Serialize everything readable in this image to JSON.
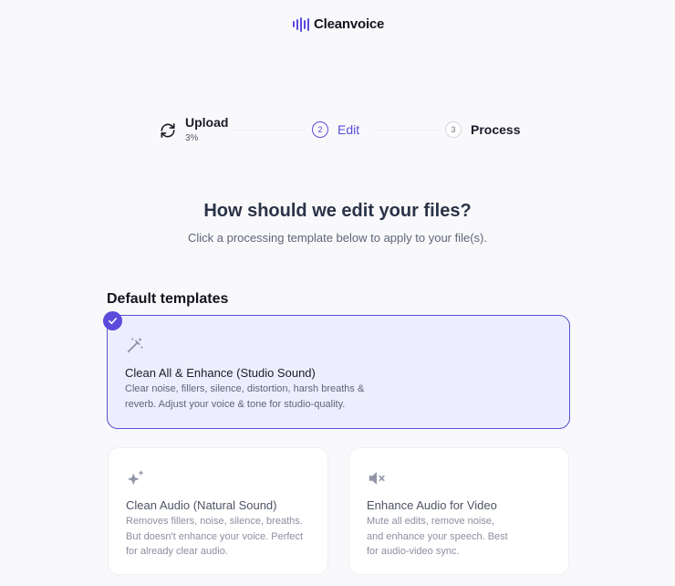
{
  "app": {
    "name": "Cleanvoice",
    "accent": "#5b4bdc"
  },
  "stepper": {
    "steps": [
      {
        "label": "Upload",
        "sub": "3%",
        "icon": "refresh-icon",
        "state": "in-progress",
        "progress_percent": 3
      },
      {
        "number": "2",
        "label": "Edit",
        "state": "active"
      },
      {
        "number": "3",
        "label": "Process",
        "state": "pending"
      }
    ]
  },
  "main": {
    "heading": "How should we edit your files?",
    "subheading": "Click a processing template below to apply to your file(s).",
    "section_title": "Default templates",
    "templates": [
      {
        "title": "Clean All & Enhance (Studio Sound)",
        "description": "Clear noise, fillers, silence, distortion, harsh breaths & reverb. Adjust your voice & tone for studio-quality.",
        "icon": "magic-wand-icon",
        "selected": true
      },
      {
        "title": "Clean Audio (Natural Sound)",
        "description": "Removes fillers, noise, silence, breaths. But doesn't enhance your voice. Perfect for already clear audio.",
        "icon": "sparkles-icon",
        "selected": false
      },
      {
        "title": "Enhance Audio for Video",
        "description": "Mute all edits, remove noise, and enhance your speech. Best for audio-video sync.",
        "icon": "speaker-mute-icon",
        "selected": false
      }
    ]
  }
}
